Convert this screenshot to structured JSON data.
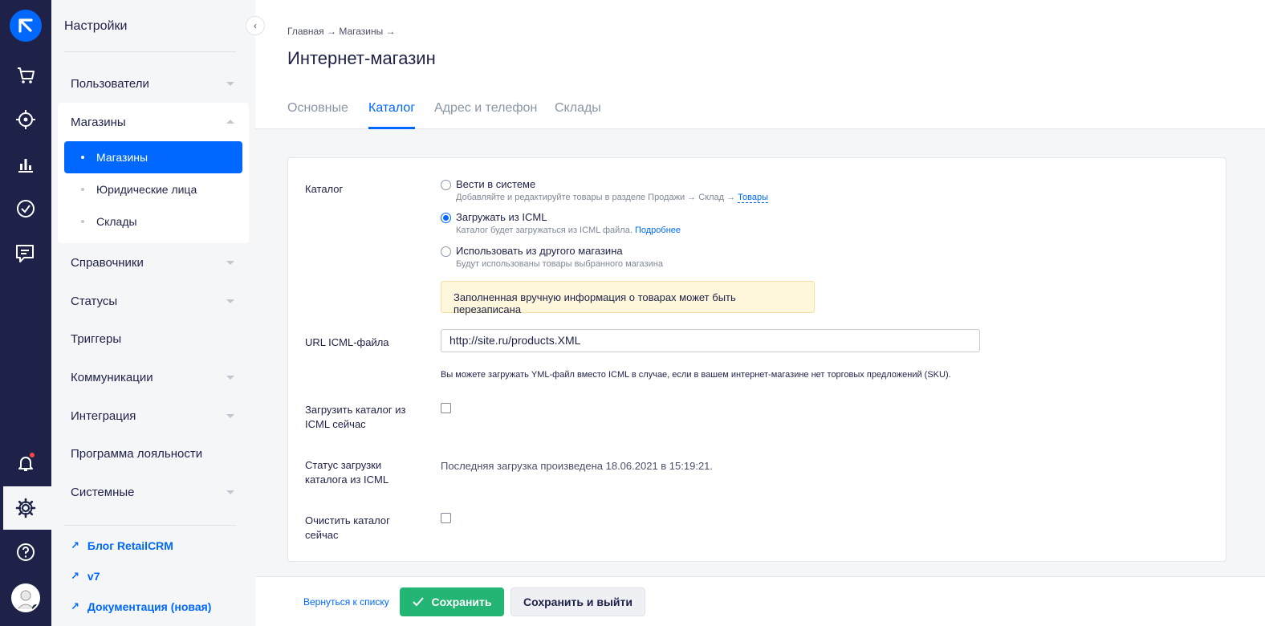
{
  "sidebar": {
    "title": "Настройки",
    "items": [
      {
        "label": "Пользователи"
      },
      {
        "label": "Магазины"
      },
      {
        "label": "Справочники"
      },
      {
        "label": "Статусы"
      },
      {
        "label": "Триггеры"
      },
      {
        "label": "Коммуникации"
      },
      {
        "label": "Интеграция"
      },
      {
        "label": "Программа лояльности"
      },
      {
        "label": "Системные"
      }
    ],
    "sub_items": [
      {
        "label": "Магазины"
      },
      {
        "label": "Юридические лица"
      },
      {
        "label": "Склады"
      }
    ],
    "links": [
      {
        "label": "Блог RetailCRM"
      },
      {
        "label": "v7"
      },
      {
        "label": "Документация (новая)"
      }
    ]
  },
  "header": {
    "breadcrumb": "Главная → Магазины →",
    "title": "Интернет-магазин",
    "tabs": [
      {
        "label": "Основные"
      },
      {
        "label": "Каталог"
      },
      {
        "label": "Адрес и телефон"
      },
      {
        "label": "Склады"
      }
    ]
  },
  "form": {
    "catalog_label": "Каталог",
    "options": [
      {
        "label": "Вести в системе",
        "hint": "Добавляйте и редактируйте товары в разделе Продажи → Склад →",
        "hint_link": "Товары"
      },
      {
        "label": "Загружать из ICML",
        "hint": "Каталог будет загружаться из ICML файла.",
        "hint_link": "Подробнее"
      },
      {
        "label": "Использовать из другого магазина",
        "hint": "Будут использованы товары выбранного магазина"
      }
    ],
    "selected_option": "Загружать из ICML",
    "warning": "Заполненная вручную информация о товарах может быть перезаписана",
    "url_label": "URL ICML-файла",
    "url_value": "http://site.ru/products.XML",
    "url_hint": "Вы можете загружать YML-файл вместо ICML в случае, если в вашем интернет-магазине нет торговых предложений (SKU).",
    "load_now_label": "Загрузить каталог из ICML сейчас",
    "status_label": "Статус загрузки каталога из ICML",
    "status_value": "Последняя загрузка произведена 18.06.2021 в 15:19:21.",
    "clear_label": "Очистить каталог сейчас"
  },
  "footer": {
    "back": "Вернуться к списку",
    "save": "Сохранить",
    "save_exit": "Сохранить и выйти"
  },
  "colors": {
    "rail": "#1e2248",
    "accent": "#0068ff",
    "save": "#22b573"
  }
}
